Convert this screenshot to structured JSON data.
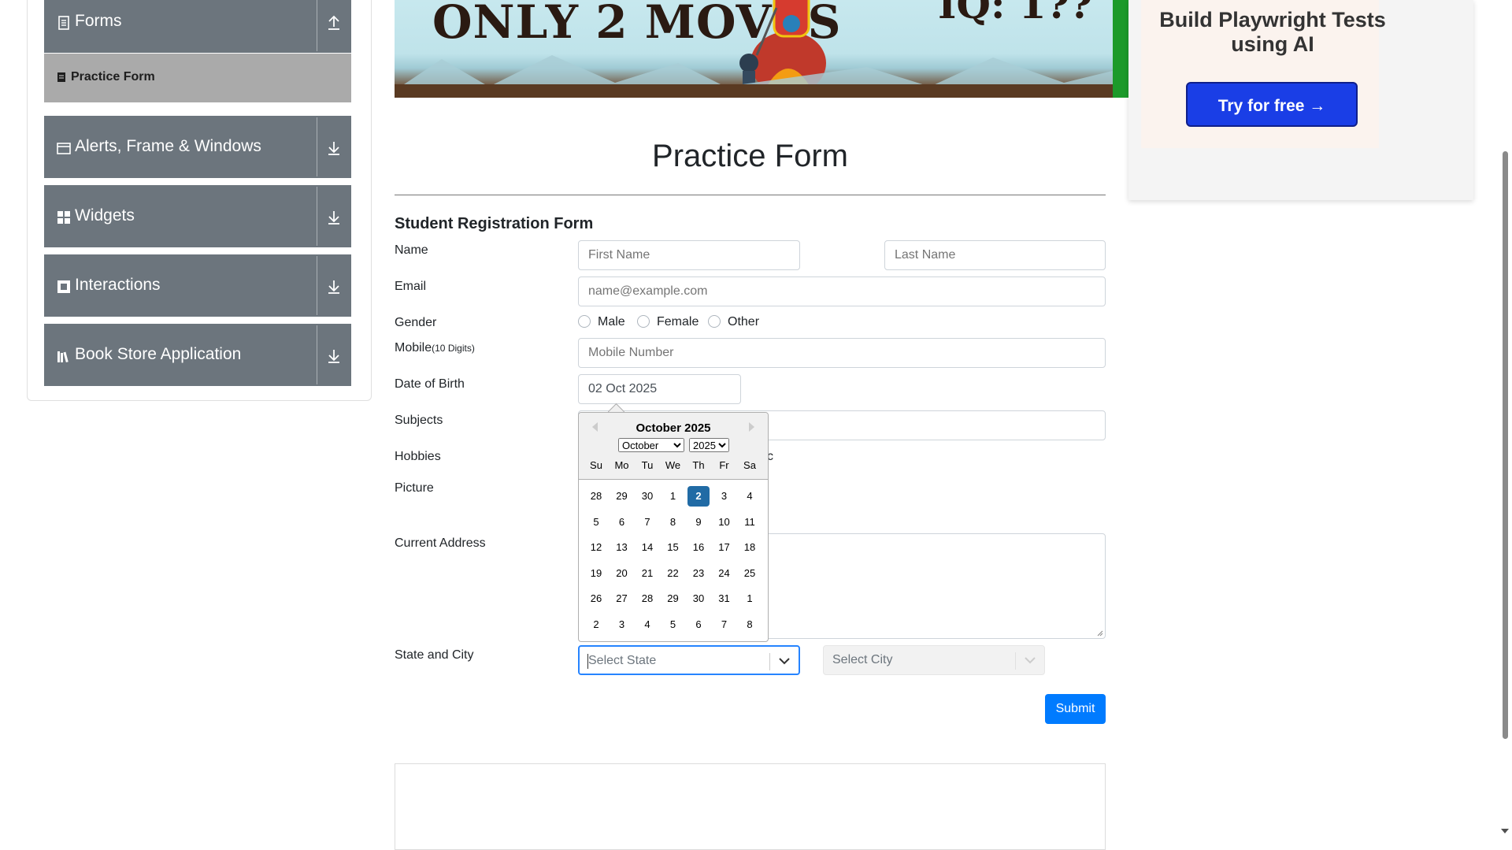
{
  "sidebar": {
    "groups": [
      {
        "label": "Forms",
        "icon": "document-icon",
        "arrow": "collapse-up-icon"
      },
      {
        "label": "Alerts, Frame & Windows",
        "icon": "window-icon",
        "arrow": "expand-down-icon"
      },
      {
        "label": "Widgets",
        "icon": "widgets-icon",
        "arrow": "expand-down-icon"
      },
      {
        "label": "Interactions",
        "icon": "interactions-icon",
        "arrow": "expand-down-icon"
      },
      {
        "label": "Book Store Application",
        "icon": "books-icon",
        "arrow": "expand-down-icon"
      }
    ],
    "active_item": "Practice Form"
  },
  "banner": {
    "title": "ONLY 2 MOVES",
    "iq_text": "IQ: 1??"
  },
  "ad": {
    "headline": "Build Playwright Tests using AI",
    "cta": "Try for free →"
  },
  "page": {
    "title": "Practice Form",
    "form_title": "Student Registration Form"
  },
  "form": {
    "name_label": "Name",
    "first_name_placeholder": "First Name",
    "last_name_placeholder": "Last Name",
    "email_label": "Email",
    "email_placeholder": "name@example.com",
    "gender_label": "Gender",
    "gender_options": [
      "Male",
      "Female",
      "Other"
    ],
    "mobile_label": "Mobile",
    "mobile_hint": "(10 Digits)",
    "mobile_placeholder": "Mobile Number",
    "dob_label": "Date of Birth",
    "dob_value": "02 Oct 2025",
    "subjects_label": "Subjects",
    "hobbies_label": "Hobbies",
    "hobbies_partial": "c",
    "picture_label": "Picture",
    "address_label": "Current Address",
    "state_city_label": "State and City",
    "state_placeholder": "Select State",
    "city_placeholder": "Select City",
    "submit_label": "Submit"
  },
  "datepicker": {
    "month_year": "October 2025",
    "month_select": "October",
    "year_select": "2025",
    "day_names": [
      "Su",
      "Mo",
      "Tu",
      "We",
      "Th",
      "Fr",
      "Sa"
    ],
    "weeks": [
      [
        "28",
        "29",
        "30",
        "1",
        "2",
        "3",
        "4"
      ],
      [
        "5",
        "6",
        "7",
        "8",
        "9",
        "10",
        "11"
      ],
      [
        "12",
        "13",
        "14",
        "15",
        "16",
        "17",
        "18"
      ],
      [
        "19",
        "20",
        "21",
        "22",
        "23",
        "24",
        "25"
      ],
      [
        "26",
        "27",
        "28",
        "29",
        "30",
        "31",
        "1"
      ],
      [
        "2",
        "3",
        "4",
        "5",
        "6",
        "7",
        "8"
      ]
    ],
    "selected_day": "2",
    "selected_color": "#216ba5"
  },
  "colors": {
    "sidebar_group": "#6c757d",
    "sidebar_active": "#aaaaaa",
    "submit": "#007bff",
    "ad_button": "#1a3ee6"
  }
}
